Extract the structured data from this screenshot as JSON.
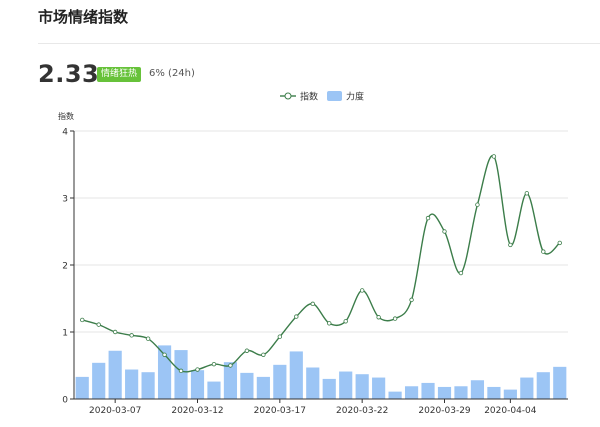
{
  "header": {
    "title": "市场情绪指数",
    "value": "2.33",
    "badge": "情绪狂热",
    "change": "6% (24h)"
  },
  "colors": {
    "line": "#3c7d4a",
    "bar": "#9cc5f5",
    "badge": "#67c23a",
    "grid": "#e6e6e6",
    "axis": "#333333"
  },
  "chart_data": {
    "type": "bar",
    "legend": [
      "指数",
      "力度"
    ],
    "legend_position": "top-center",
    "ylabel": "指数",
    "ylim": [
      0,
      4
    ],
    "yticks": [
      "0",
      "1",
      "2",
      "3",
      "4"
    ],
    "x_tick_labels": [
      {
        "index": 2,
        "label": "2020-03-07"
      },
      {
        "index": 7,
        "label": "2020-03-12"
      },
      {
        "index": 12,
        "label": "2020-03-17"
      },
      {
        "index": 17,
        "label": "2020-03-22"
      },
      {
        "index": 22,
        "label": "2020-03-29"
      },
      {
        "index": 26,
        "label": "2020-04-04"
      }
    ],
    "grid": true,
    "series": [
      {
        "name": "指数",
        "type": "line",
        "smooth": true,
        "values": [
          1.18,
          1.11,
          1.0,
          0.95,
          0.9,
          0.66,
          0.42,
          0.44,
          0.52,
          0.5,
          0.72,
          0.66,
          0.93,
          1.23,
          1.42,
          1.13,
          1.16,
          1.62,
          1.22,
          1.2,
          1.48,
          2.7,
          2.5,
          1.88,
          2.9,
          3.62,
          2.3,
          3.07,
          2.2,
          2.33
        ]
      },
      {
        "name": "力度",
        "type": "bar",
        "values": [
          0.33,
          0.54,
          0.72,
          0.44,
          0.4,
          0.8,
          0.73,
          0.43,
          0.26,
          0.55,
          0.39,
          0.33,
          0.51,
          0.71,
          0.47,
          0.3,
          0.41,
          0.37,
          0.32,
          0.11,
          0.19,
          0.24,
          0.18,
          0.19,
          0.28,
          0.18,
          0.14,
          0.32,
          0.4,
          0.48
        ]
      }
    ]
  }
}
